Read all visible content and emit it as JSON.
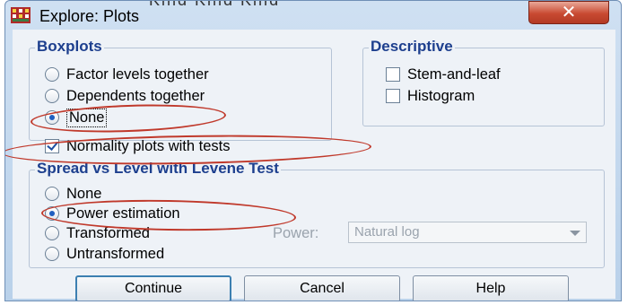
{
  "window": {
    "title": "Explore: Plots",
    "close_label": "✕",
    "background_text": "Kind    Kind    Kind"
  },
  "boxplots": {
    "legend": "Boxplots",
    "options": [
      {
        "label": "Factor levels together",
        "selected": false
      },
      {
        "label": "Dependents together",
        "selected": false
      },
      {
        "label": "None",
        "selected": true
      }
    ]
  },
  "descriptive": {
    "legend": "Descriptive",
    "options": [
      {
        "label": "Stem-and-leaf",
        "checked": false
      },
      {
        "label": "Histogram",
        "checked": false
      }
    ]
  },
  "normality": {
    "label": "Normality plots with tests",
    "checked": true
  },
  "spread": {
    "legend": "Spread vs Level with Levene Test",
    "options": [
      {
        "label": "None",
        "selected": false
      },
      {
        "label": "Power estimation",
        "selected": true
      },
      {
        "label": "Transformed",
        "selected": false
      },
      {
        "label": "Untransformed",
        "selected": false
      }
    ],
    "power_label": "Power:",
    "power_value": "Natural log"
  },
  "buttons": {
    "continue": "Continue",
    "cancel": "Cancel",
    "help": "Help"
  },
  "colors": {
    "legend": "#1d3f8e",
    "annotation": "#c0392b",
    "close_button": "#c94a32"
  }
}
